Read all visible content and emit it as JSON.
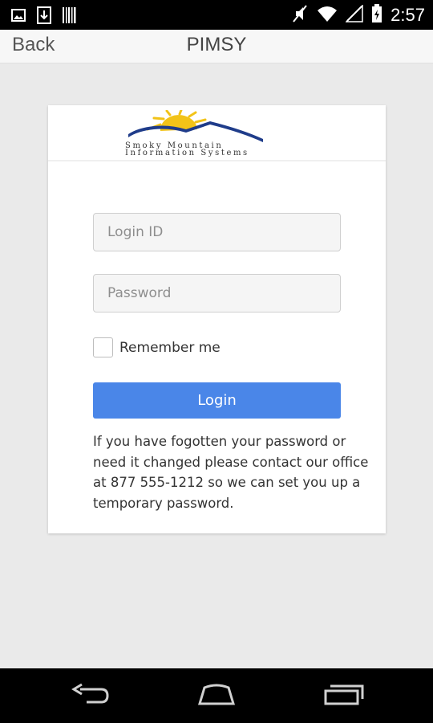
{
  "status_bar": {
    "time": "2:57",
    "icons": [
      "image-icon",
      "download-icon",
      "barcode-icon",
      "mute-icon",
      "wifi-icon",
      "signal-icon",
      "battery-icon"
    ]
  },
  "action_bar": {
    "back_label": "Back",
    "title": "PIMSY"
  },
  "logo": {
    "line1": "Smoky Mountain",
    "line2": "Information Systems",
    "colors": {
      "sun": "#f2c318",
      "mountain": "#1f3c8a"
    }
  },
  "form": {
    "login_id_placeholder": "Login ID",
    "login_id_value": "",
    "password_placeholder": "Password",
    "password_value": "",
    "remember_label": "Remember me",
    "login_button_label": "Login",
    "help_text": "If you have fogotten your password or need it changed please contact our office at 877 555-1212 so we can set you up a temporary password."
  },
  "nav_bar": {
    "icons": [
      "back-icon",
      "home-icon",
      "recents-icon"
    ]
  },
  "colors": {
    "accent": "#4a86e8",
    "background": "#eaeaea"
  }
}
